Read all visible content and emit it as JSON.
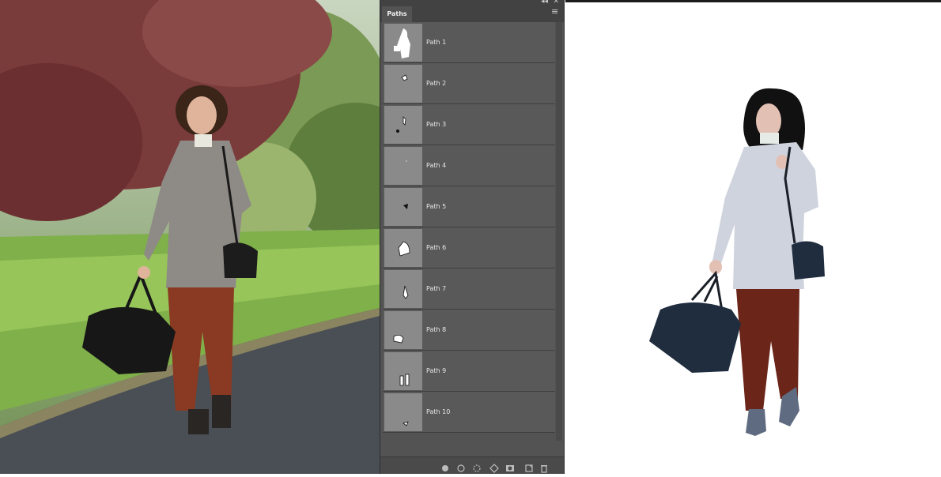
{
  "panel": {
    "tab_label": "Paths",
    "collapse_glyph": "◂◂",
    "close_glyph": "✕",
    "menu_glyph": "≡",
    "paths": [
      {
        "label": "Path 1"
      },
      {
        "label": "Path 2"
      },
      {
        "label": "Path 3"
      },
      {
        "label": "Path 4"
      },
      {
        "label": "Path 5"
      },
      {
        "label": "Path 6"
      },
      {
        "label": "Path 7"
      },
      {
        "label": "Path 8"
      },
      {
        "label": "Path 9"
      },
      {
        "label": "Path 10"
      }
    ],
    "footer_icons": [
      "fill-path-icon",
      "stroke-path-icon",
      "load-selection-icon",
      "make-work-path-icon",
      "add-mask-icon",
      "new-path-icon",
      "delete-path-icon"
    ]
  },
  "colors": {
    "panel_bg": "#535353",
    "thumb_bg": "#8a8a8a",
    "coat": "#cfd3de",
    "pants": "#6b2519",
    "bag": "#1f2d3f",
    "boots": "#5f6b80",
    "hair": "#111111",
    "skin": "#e3c0b4"
  }
}
